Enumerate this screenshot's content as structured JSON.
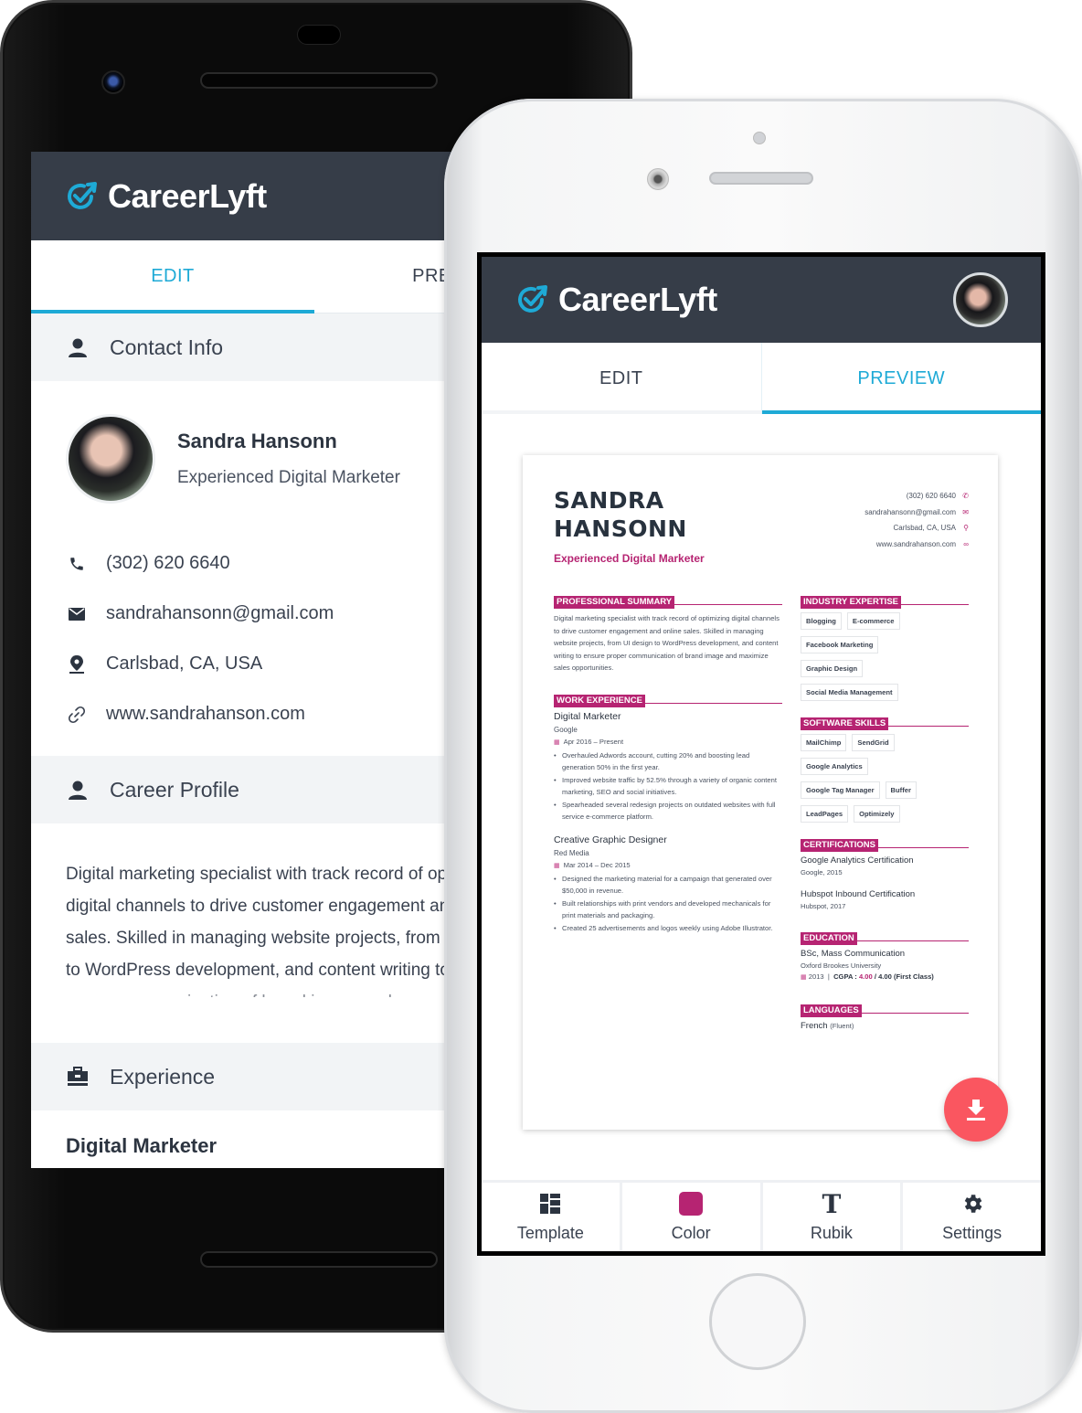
{
  "brand": {
    "name": "CareerLyft",
    "accent": "#1eaad6",
    "header_bg": "#363d48",
    "resume_accent": "#b62472",
    "fab_color": "#fa5660"
  },
  "android": {
    "tabs": [
      {
        "label": "EDIT",
        "active": true
      },
      {
        "label": "PREVIEW",
        "active": false
      }
    ],
    "sections": {
      "contact": {
        "title": "Contact Info",
        "icon": "user-icon"
      },
      "career": {
        "title": "Career Profile",
        "icon": "user-icon"
      },
      "experience": {
        "title": "Experience",
        "icon": "briefcase-icon"
      }
    },
    "profile": {
      "name": "Sandra Hansonn",
      "title": "Experienced Digital Marketer"
    },
    "contact": [
      {
        "icon": "phone-icon",
        "value": "(302) 620 6640"
      },
      {
        "icon": "envelope-icon",
        "value": "sandrahansonn@gmail.com"
      },
      {
        "icon": "location-pin-icon",
        "value": "Carlsbad, CA, USA"
      },
      {
        "icon": "link-icon",
        "value": "www.sandrahanson.com"
      }
    ],
    "career_lines": [
      "Digital marketing specialist with track record of optimizing",
      "digital channels to drive customer engagement and online",
      "sales. Skilled in managing website projects, from UI design",
      "to WordPress development, and content writing to ensure",
      "proper communication of brand image and"
    ],
    "experience_first_job": "Digital Marketer"
  },
  "iphone": {
    "tabs": [
      {
        "label": "EDIT",
        "active": false
      },
      {
        "label": "PREVIEW",
        "active": true
      }
    ],
    "bottom_bar": [
      {
        "label": "Template",
        "icon": "template-grid-icon"
      },
      {
        "label": "Color",
        "icon": "color-swatch-icon",
        "color": "#b62472"
      },
      {
        "label": "Rubik",
        "icon": "font-icon"
      },
      {
        "label": "Settings",
        "icon": "gear-icon"
      }
    ],
    "fab_icon": "download-icon"
  },
  "resume": {
    "name_line1": "SANDRA",
    "name_line2": "HANSONN",
    "subtitle": "Experienced Digital Marketer",
    "contact": [
      {
        "value": "(302) 620 6640",
        "icon": "phone-icon"
      },
      {
        "value": "sandrahansonn@gmail.com",
        "icon": "envelope-icon"
      },
      {
        "value": "Carlsbad, CA, USA",
        "icon": "location-pin-icon"
      },
      {
        "value": "www.sandrahanson.com",
        "icon": "link-icon"
      }
    ],
    "summary_heading": "PROFESSIONAL SUMMARY",
    "summary": "Digital marketing specialist with track record of optimizing digital channels to drive customer engagement and online sales. Skilled in managing website projects, from UI design to WordPress development, and content writing to ensure proper communication of brand image and maximize sales opportunities.",
    "work_heading": "WORK EXPERIENCE",
    "jobs": [
      {
        "title": "Digital Marketer",
        "company": "Google",
        "dates": "Apr 2016 – Present",
        "bullets": [
          "Overhauled Adwords account, cutting 20% and boosting lead generation 50% in the first year.",
          "Improved website traffic by 52.5% through a variety of organic content marketing, SEO and social initiatives.",
          "Spearheaded several redesign projects on outdated websites with full service e-commerce platform."
        ]
      },
      {
        "title": "Creative Graphic Designer",
        "company": "Red Media",
        "dates": "Mar 2014 – Dec 2015",
        "bullets": [
          "Designed the marketing material for a campaign that generated over $50,000 in revenue.",
          "Built relationships with print vendors and developed mechanicals for print materials and packaging.",
          "Created 25 advertisements and logos weekly using Adobe Illustrator."
        ]
      }
    ],
    "expertise_heading": "INDUSTRY EXPERTISE",
    "expertise": [
      "Blogging",
      "E-commerce",
      "Facebook Marketing",
      "Graphic Design",
      "Social Media Management"
    ],
    "software_heading": "SOFTWARE SKILLS",
    "software": [
      "MailChimp",
      "SendGrid",
      "Google Analytics",
      "Google Tag Manager",
      "Buffer",
      "LeadPages",
      "Optimizely"
    ],
    "cert_heading": "CERTIFICATIONS",
    "certifications": [
      {
        "title": "Google Analytics Certification",
        "sub": "Google, 2015"
      },
      {
        "title": "Hubspot Inbound Certification",
        "sub": "Hubspot, 2017"
      }
    ],
    "edu_heading": "EDUCATION",
    "education": {
      "degree": "BSc, Mass Communication",
      "school": "Oxford Brookes University",
      "year": "2013",
      "cgpa_label": "CGPA :",
      "cgpa_value": "4.00",
      "cgpa_max": "/ 4.00 (First Class)"
    },
    "lang_heading": "LANGUAGES",
    "language": {
      "name": "French",
      "level": "(Fluent)"
    }
  }
}
